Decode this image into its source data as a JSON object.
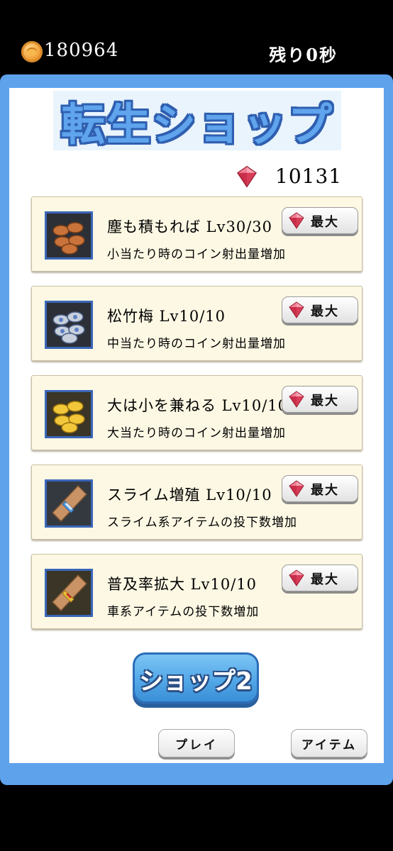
{
  "header": {
    "coins": "180964",
    "time_left": "残り0秒",
    "coin_icon": "gold-coin-icon"
  },
  "shop": {
    "title": "転生ショップ",
    "gem_total": "10131",
    "gem_icon": "ruby-gem-icon"
  },
  "items": [
    {
      "name": "塵も積もれば Lv30/30",
      "desc": "小当たり時のコイン射出量増加",
      "button": "最大",
      "icon": "bronze-coin-stack-icon"
    },
    {
      "name": "松竹梅 Lv10/10",
      "desc": "中当たり時のコイン射出量増加",
      "button": "最大",
      "icon": "silver-coin-stack-icon"
    },
    {
      "name": "大は小を兼ねる Lv10/10",
      "desc": "大当たり時のコイン射出量増加",
      "button": "最大",
      "icon": "gold-coin-stack-icon"
    },
    {
      "name": "スライム増殖 Lv10/10",
      "desc": "スライム系アイテムの投下数増加",
      "button": "最大",
      "icon": "scroll-blue-icon"
    },
    {
      "name": "普及率拡大 Lv10/10",
      "desc": "車系アイテムの投下数増加",
      "button": "最大",
      "icon": "scroll-yellow-icon"
    }
  ],
  "buttons": {
    "shop2": "ショップ2",
    "play": "プレイ",
    "item": "アイテム"
  },
  "colors": {
    "frame": "#5ea2ec",
    "title_fill": "#5fa4ec",
    "title_outline": "#2f5fb0",
    "card_bg": "#fdf8e4",
    "gem": "#e0405a"
  }
}
